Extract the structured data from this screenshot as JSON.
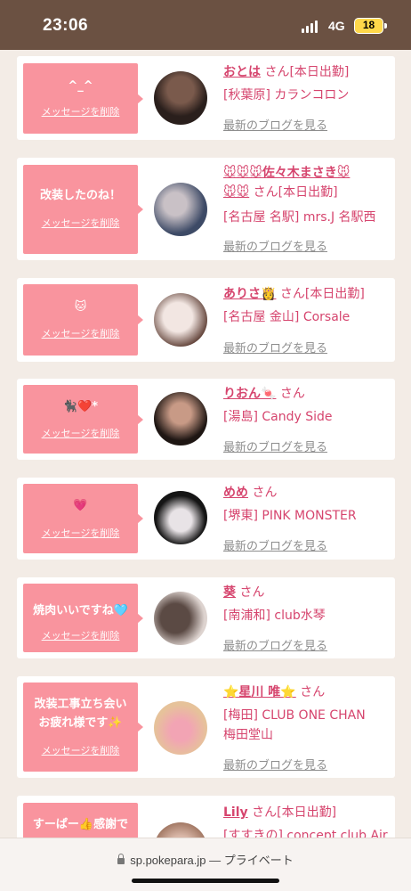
{
  "status": {
    "time": "23:06",
    "network": "4G",
    "battery": "18"
  },
  "delete_label": "メッセージを削除",
  "blog_label": "最新のブログを見る",
  "cards": [
    {
      "message": "^_^",
      "name": "おとは",
      "san": "さん",
      "tag": "[本日出勤]",
      "shop": "[秋葉原] カランコロン",
      "avatar_colors": [
        "#2a1f1c",
        "#7a5a4c"
      ]
    },
    {
      "message": "改装したのね！",
      "name": "🐭🐭🐭佐々木まさき🐭",
      "name2": "🐭🐭",
      "san": "さん",
      "tag": "[本日出勤]",
      "shop": "[名古屋 名駅] mrs.J 名駅西",
      "avatar_colors": [
        "#3d4a66",
        "#c9c1c6"
      ]
    },
    {
      "message": "🐱",
      "name": "ありさ👸",
      "san": "さん",
      "tag": "[本日出勤]",
      "shop": "[名古屋 金山] Corsale",
      "avatar_colors": [
        "#f2e6e2",
        "#5a3a30"
      ]
    },
    {
      "message": "🐈‍⬛❤️‍*",
      "name": "りおん🍬",
      "san": "さん",
      "tag": "",
      "shop": "[湯島] Candy Side",
      "avatar_colors": [
        "#1e1613",
        "#c89a86"
      ]
    },
    {
      "message": "💗",
      "name": "めめ",
      "san": "さん",
      "tag": "",
      "shop": "[堺東] PINK MONSTER",
      "avatar_colors": [
        "#151515",
        "#e8e3e6"
      ]
    },
    {
      "message": "焼肉いいですね🩵",
      "name": "葵",
      "san": "さん",
      "tag": "",
      "shop": "[南浦和] club水琴",
      "avatar_colors": [
        "#5b4a44",
        "#ddd3cf"
      ]
    },
    {
      "message": "改装工事立ち会い\nお疲れ様です✨",
      "name": "⭐星川 唯⭐",
      "san": "さん",
      "tag": "",
      "shop": "[梅田] CLUB ONE CHAN",
      "shop2": "梅田堂山",
      "avatar_colors": [
        "#e6c29a",
        "#f2a4b4"
      ]
    },
    {
      "message": "すーぱー👍感謝で",
      "name": "Lily",
      "san": "さん",
      "tag": "[本日出勤]",
      "shop": "[すすきの] concept club Air",
      "avatar_colors": [
        "#d9b7a8",
        "#a47a66"
      ]
    }
  ],
  "url_bar": {
    "domain": "sp.pokepara.jp",
    "mode": "— プライベート"
  }
}
